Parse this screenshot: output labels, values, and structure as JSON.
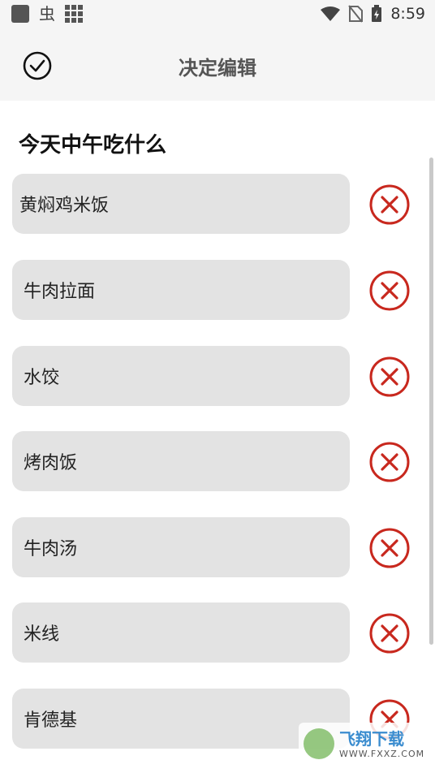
{
  "status_bar": {
    "time": "8:59",
    "left_glyph": "虫"
  },
  "toolbar": {
    "title": "决定编辑"
  },
  "list": {
    "title": "今天中午吃什么",
    "items": [
      {
        "label": "黄焖鸡米饭"
      },
      {
        "label": "牛肉拉面"
      },
      {
        "label": "水饺"
      },
      {
        "label": "烤肉饭"
      },
      {
        "label": "牛肉汤"
      },
      {
        "label": "米线"
      },
      {
        "label": "肯德基"
      }
    ]
  },
  "watermark": {
    "name": "飞翔下载",
    "url": "WWW.FXXZ.COM"
  },
  "colors": {
    "delete_red": "#c8281e",
    "item_bg": "#e3e3e3",
    "toolbar_bg": "#f5f5f5"
  },
  "icons": {
    "confirm": "check-circle-icon",
    "delete": "close-circle-icon"
  }
}
